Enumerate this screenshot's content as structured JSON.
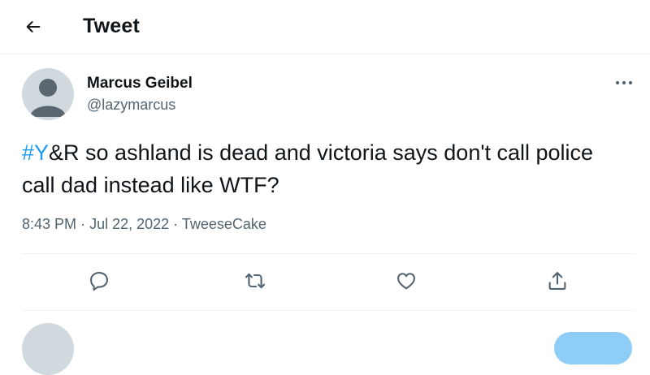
{
  "header": {
    "title": "Tweet",
    "back_icon": "arrow-left-icon"
  },
  "author": {
    "display_name": "Marcus Geibel",
    "handle": "@lazymarcus",
    "avatar_icon": "default-avatar-icon"
  },
  "tweet": {
    "hashtag": "#Y",
    "text": "&R so ashland is dead and victoria says don't call police call dad instead like WTF?",
    "time": "8:43 PM",
    "separator": "·",
    "date": "Jul 22, 2022",
    "source": "TweeseCake"
  },
  "actions": [
    {
      "name": "reply",
      "icon": "reply-icon"
    },
    {
      "name": "retweet",
      "icon": "retweet-icon"
    },
    {
      "name": "like",
      "icon": "heart-icon"
    },
    {
      "name": "share",
      "icon": "share-icon"
    }
  ],
  "more_icon": "more-horizontal-icon",
  "colors": {
    "accent": "#1d9bf0",
    "text": "#0f1419",
    "muted": "#536471",
    "border": "#eff3f4",
    "reply_button": "#8ecdf8"
  }
}
